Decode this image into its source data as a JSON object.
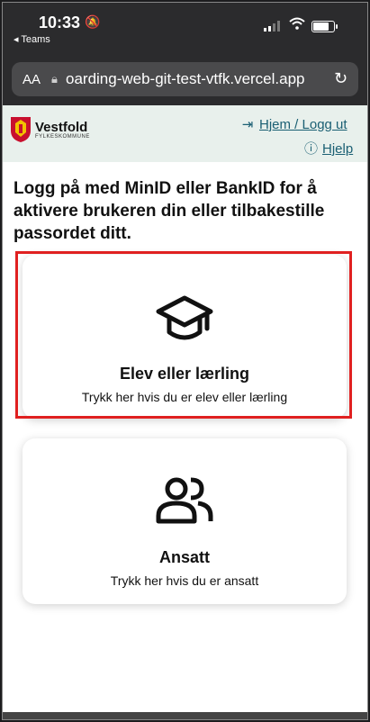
{
  "status": {
    "time": "10:33",
    "back_app": "◂ Teams",
    "battery_level": 0.85
  },
  "browser": {
    "text_size_label": "AA",
    "url": "oarding-web-git-test-vtfk.vercel.app"
  },
  "header": {
    "org_name": "Vestfold",
    "org_sub": "FYLKESKOMMUNE",
    "home_link": "Hjem / Logg ut",
    "help_link": "Hjelp"
  },
  "intro": "Logg på med MinID eller BankID for å aktivere brukeren din eller tilbakestille passordet ditt.",
  "cards": [
    {
      "title": "Elev eller lærling",
      "subtitle": "Trykk her hvis du er elev eller lærling",
      "icon": "graduation-cap-icon"
    },
    {
      "title": "Ansatt",
      "subtitle": "Trykk her hvis du er ansatt",
      "icon": "users-icon"
    }
  ],
  "colors": {
    "accent": "#1a5f73",
    "header_bg": "#e8f0ec",
    "highlight": "#e02020"
  }
}
